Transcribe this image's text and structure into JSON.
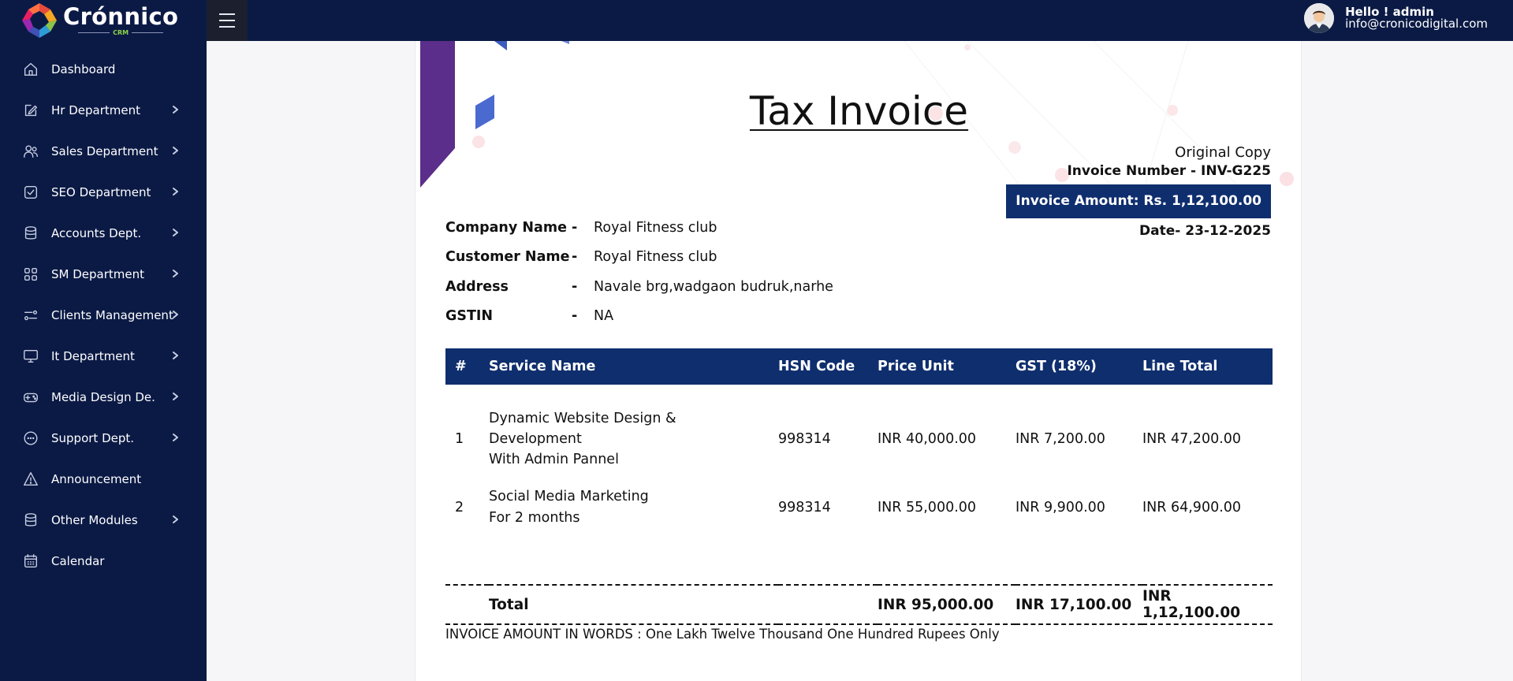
{
  "brand": {
    "name": "Crónnico",
    "sub": "CRM"
  },
  "sidebar": {
    "items": [
      {
        "label": "Dashboard",
        "icon": "home-icon",
        "has_chevron": false
      },
      {
        "label": "Hr Department",
        "icon": "edit-icon",
        "has_chevron": true
      },
      {
        "label": "Sales Department",
        "icon": "users-icon",
        "has_chevron": true
      },
      {
        "label": "SEO Department",
        "icon": "check-square-icon",
        "has_chevron": true
      },
      {
        "label": "Accounts Dept.",
        "icon": "database-icon",
        "has_chevron": true
      },
      {
        "label": "SM Department",
        "icon": "grid-icon",
        "has_chevron": true
      },
      {
        "label": "Clients Management",
        "icon": "sliders-icon",
        "has_chevron": true
      },
      {
        "label": "It Department",
        "icon": "monitor-icon",
        "has_chevron": true
      },
      {
        "label": "Media Design De.",
        "icon": "gamepad-icon",
        "has_chevron": true
      },
      {
        "label": "Support Dept.",
        "icon": "chat-icon",
        "has_chevron": true
      },
      {
        "label": "Announcement",
        "icon": "alert-icon",
        "has_chevron": false
      },
      {
        "label": "Other Modules",
        "icon": "database-icon",
        "has_chevron": true
      },
      {
        "label": "Calendar",
        "icon": "calendar-icon",
        "has_chevron": false
      }
    ]
  },
  "header": {
    "greeting": "Hello ! admin",
    "email": "info@cronicodigital.com"
  },
  "invoice": {
    "title": "Tax Invoice",
    "copy_label": "Original Copy",
    "invoice_number": "Invoice Number - INV-G225",
    "amount_label": "Invoice Amount: Rs. 1,12,100.00",
    "date": "Date- 23-12-2025",
    "info": [
      {
        "label": "Company Name",
        "dash": "-",
        "value": "Royal Fitness club"
      },
      {
        "label": "Customer Name",
        "dash": "-",
        "value": "Royal Fitness club"
      },
      {
        "label": "Address",
        "dash": "-",
        "value": "Navale brg,wadgaon budruk,narhe"
      },
      {
        "label": "GSTIN",
        "dash": "-",
        "value": "NA"
      }
    ],
    "table": {
      "headers": [
        "#",
        "Service Name",
        "HSN Code",
        "Price Unit",
        "GST (18%)",
        "Line Total"
      ],
      "rows": [
        {
          "num": "1",
          "service_lines": [
            "Dynamic Website Design &",
            "Development",
            "With Admin Pannel"
          ],
          "hsn": "998314",
          "price": "INR 40,000.00",
          "gst": "INR 7,200.00",
          "total": "INR 47,200.00"
        },
        {
          "num": "2",
          "service_lines": [
            "Social Media Marketing",
            "For 2 months"
          ],
          "hsn": "998314",
          "price": "INR 55,000.00",
          "gst": "INR 9,900.00",
          "total": "INR 64,900.00"
        }
      ],
      "totals": {
        "label": "Total",
        "price": "INR 95,000.00",
        "gst": "INR 17,100.00",
        "total": "INR 1,12,100.00"
      }
    },
    "amount_in_words": "INVOICE AMOUNT IN WORDS : One Lakh Twelve Thousand One Hundred Rupees Only"
  },
  "colors": {
    "sidebar_bg": "#0b1a45",
    "accent": "#0f2e6e",
    "deco_purple": "#5a2e8a",
    "deco_blue": "#4a6ad0"
  }
}
